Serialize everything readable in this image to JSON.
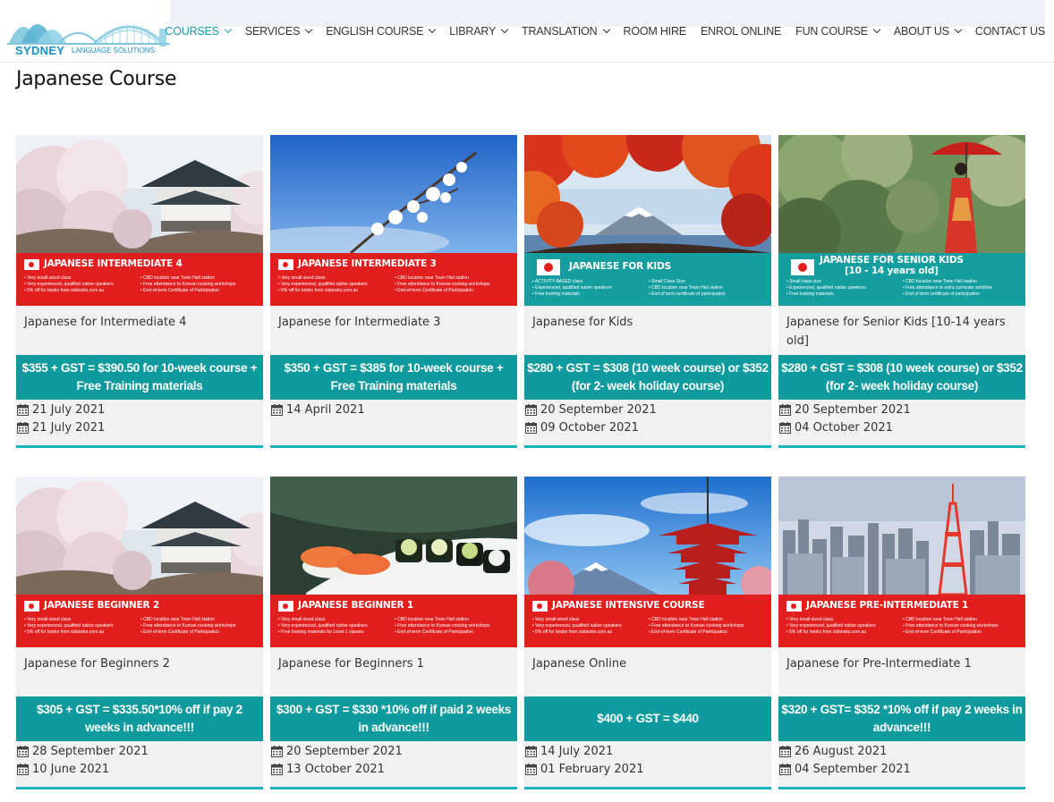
{
  "logo": {
    "brand": "SYDNEY",
    "sub": "LANGUAGE SOLUTIONS"
  },
  "nav": [
    {
      "label": "COURSES",
      "dropdown": true,
      "active": true
    },
    {
      "label": "SERVICES",
      "dropdown": true
    },
    {
      "label": "ENGLISH COURSE",
      "dropdown": true
    },
    {
      "label": "LIBRARY",
      "dropdown": true
    },
    {
      "label": "TRANSLATION",
      "dropdown": true
    },
    {
      "label": "ROOM HIRE",
      "dropdown": false
    },
    {
      "label": "ENROL ONLINE",
      "dropdown": false
    },
    {
      "label": "FUN COURSE",
      "dropdown": true
    },
    {
      "label": "ABOUT US",
      "dropdown": true
    },
    {
      "label": "CONTACT US",
      "dropdown": false
    }
  ],
  "page_title": "Japanese Course",
  "colors": {
    "accent": "#0f9eaa",
    "price_bg": "#0f9a9e",
    "banner_red": "#e11f1f",
    "banner_teal": "#159ea0",
    "card_bg": "#f1f1f1"
  },
  "cards": [
    {
      "banner_title": "JAPANESE INTERMEDIATE 4",
      "banner_style": "red",
      "photo": "castle-blossom",
      "bullets": [
        "• Very small-sized class",
        "• CBD location near Town Hall station",
        "• Very experienced, qualified native speakers",
        "• Free attendance to Korean cooking workshops",
        "• 5% off for books from slsbooks.com.au",
        "• End-of-term Certificate of Participation"
      ],
      "name": "Japanese for Intermediate 4",
      "price": "$355 + GST = $390.50 for 10-week course + Free Training materials",
      "dates": [
        "21 July 2021",
        "21 July 2021"
      ]
    },
    {
      "banner_title": "JAPANESE INTERMEDIATE 3",
      "banner_style": "red",
      "photo": "blossom-sky",
      "bullets": [
        "• Very small-sized class",
        "• CBD location near Town Hall station",
        "• Very experienced, qualified native speakers",
        "• Free attendance to Korean cooking workshops",
        "• 5% off for books from slsbooks.com.au",
        "• End-of-term Certificate of Participation"
      ],
      "name": "Japanese for Intermediate 3",
      "price": "$350 + GST = $385 for 10-week course + Free Training materials",
      "dates": [
        "14 April 2021"
      ]
    },
    {
      "banner_title": "JAPANESE  FOR  KIDS",
      "banner_style": "teal",
      "photo": "fuji-autumn",
      "bullets": [
        "• ACTIVITY-BASED class",
        "• Small Class Size",
        "• Experienced, qualified native speakers",
        "• CBD location near Town Hall station",
        "• Free training materials",
        "• End of term certificate of participation"
      ],
      "name": "Japanese for Kids",
      "price": "$280 + GST = $308 (10 week course) or $352 (for 2- week holiday course)",
      "dates": [
        "20 September 2021",
        "09 October 2021"
      ]
    },
    {
      "banner_title": "JAPANESE FOR SENIOR KIDS",
      "banner_title_2": "[10 - 14 years old]",
      "banner_style": "teal",
      "photo": "kimono-umbrella",
      "bullets": [
        "• Small class size",
        "• CBD location near Town Hall station",
        "• Experienced, qualified native speakers",
        "• Free attendance to extra curricular activities",
        "• Free training materials",
        "• End of term certificate of participation"
      ],
      "name": "Japanese for Senior Kids [10-14 years old]",
      "price": "$280 + GST = $308 (10 week course) or $352 (for 2- week holiday course)",
      "dates": [
        "20 September 2021",
        "04 October 2021"
      ]
    },
    {
      "banner_title": "JAPANESE BEGINNER 2",
      "banner_style": "red",
      "photo": "castle-blossom",
      "bullets": [
        "• Very small-sized class",
        "• CBD location near Town Hall station",
        "• Very experienced, qualified native speakers",
        "• Free attendance to Korean cooking workshops",
        "• 5% off for books from slsbooks.com.au",
        "• End-of-term Certificate of Participation"
      ],
      "name": "Japanese for Beginners 2",
      "price": "$305 + GST = $335.50*10% off if pay 2 weeks in advance!!!",
      "dates": [
        "28 September 2021",
        "10 June 2021"
      ]
    },
    {
      "banner_title": "JAPANESE BEGINNER 1",
      "banner_style": "red",
      "photo": "sushi",
      "bullets": [
        "• Very small-sized class",
        "• CBD location near Town Hall station",
        "• Very experienced, qualified native speakers",
        "• Free attendance to Korean cooking workshops",
        "• Free training materials for Level 1 classes",
        "• End-of-term Certificate of Participation"
      ],
      "name": "Japanese for Beginners 1",
      "price": "$300 + GST = $330 *10% off if paid 2 weeks in advance!!!",
      "dates": [
        "20 September 2021",
        "13 October 2021"
      ]
    },
    {
      "banner_title": "JAPANESE INTENSIVE COURSE",
      "banner_style": "red",
      "photo": "pagoda-fuji",
      "bullets": [
        "• Very small-sized class",
        "• CBD location near Town Hall station",
        "• Very experienced, qualified native speakers",
        "• Free attendance to Korean cooking workshops",
        "• 5% off for books from slsbooks.com.au",
        "• End-of-term Certificate of Participation"
      ],
      "name": "Japanese Online",
      "price": "$400 + GST = $440",
      "dates": [
        "14 July 2021",
        "01 February 2021"
      ]
    },
    {
      "banner_title": "JAPANESE PRE-INTERMEDIATE 1",
      "banner_style": "red",
      "photo": "tokyo-city",
      "bullets": [
        "• Very small-sized class",
        "• CBD location near Town Hall station",
        "• Very experienced, qualified native speakers",
        "• Free attendance to Korean cooking workshops",
        "• 5% off for books from slsbooks.com.au",
        "• End-of-term Certificate of Participation"
      ],
      "name": "Japanese for Pre-Intermediate 1",
      "price": "$320 + GST= $352 *10% off if pay 2 weeks in advance!!!",
      "dates": [
        "26 August 2021",
        "04 September 2021"
      ]
    }
  ]
}
